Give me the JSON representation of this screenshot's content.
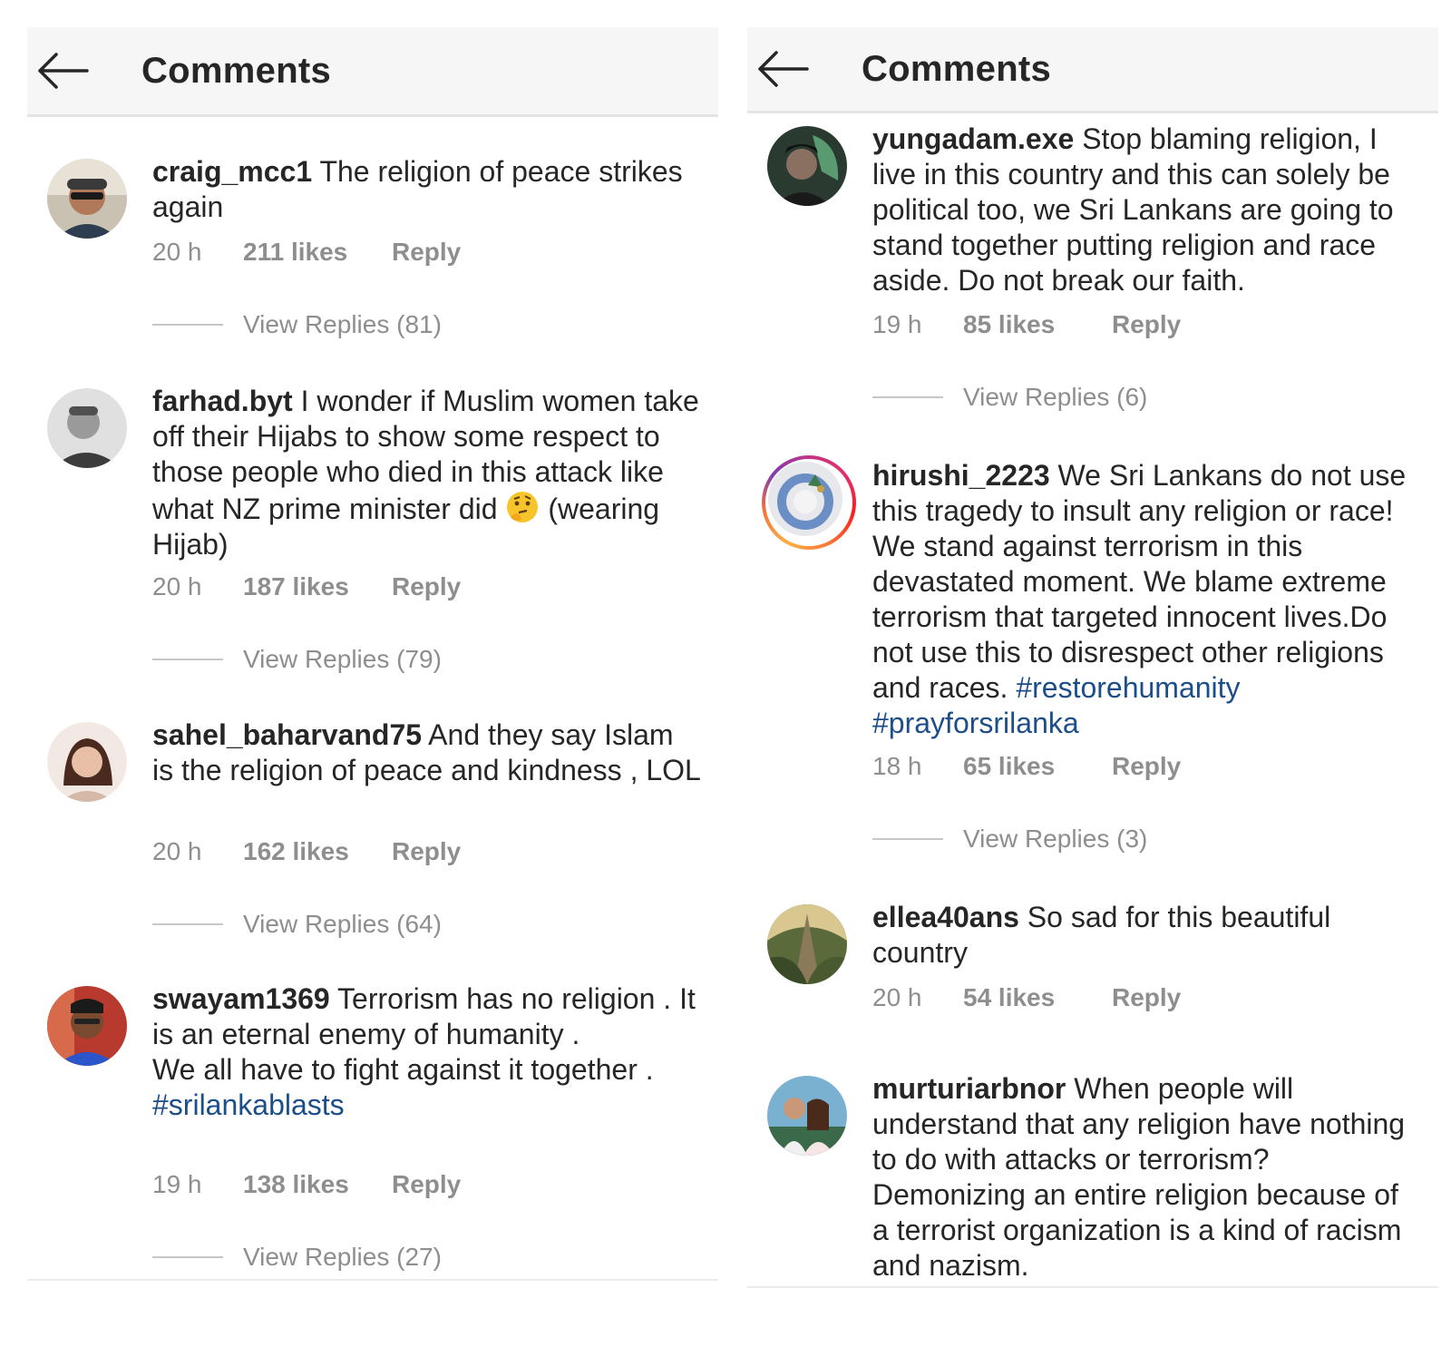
{
  "panels": [
    {
      "title": "Comments",
      "comments": [
        {
          "user": "craig_mcc1",
          "text": "The religion of peace strikes again",
          "time": "20 h",
          "likes": "211 likes",
          "reply": "Reply",
          "view_replies": "View Replies (81)"
        },
        {
          "user": "farhad.byt",
          "text": "I wonder if Muslim women take off their Hijabs to show some respect to those people who died in this attack like what NZ prime minister did",
          "emoji": "thinking-face",
          "text_after": "(wearing Hijab)",
          "time": "20 h",
          "likes": "187 likes",
          "reply": "Reply",
          "view_replies": "View Replies (79)"
        },
        {
          "user": "sahel_baharvand75",
          "text": "And they say Islam is the religion of peace and kindness , LOL",
          "time": "20 h",
          "likes": "162 likes",
          "reply": "Reply",
          "view_replies": "View Replies (64)"
        },
        {
          "user": "swayam1369",
          "text": "Terrorism has no religion . It is an eternal enemy of humanity .",
          "text2": "We all have to fight against it together .",
          "hashtag": "#srilankablasts",
          "time": "19 h",
          "likes": "138 likes",
          "reply": "Reply",
          "view_replies": "View Replies (27)"
        }
      ]
    },
    {
      "title": "Comments",
      "comments": [
        {
          "user": "yungadam.exe",
          "text": "Stop blaming religion, I live in this country and this can solely be political too, we Sri Lankans are going to stand together putting religion and race aside. Do not break our faith.",
          "time": "19 h",
          "likes": "85 likes",
          "reply": "Reply",
          "view_replies": "View Replies (6)"
        },
        {
          "user": "hirushi_2223",
          "text": "We Sri Lankans do not use this tragedy to insult any religion or race! We stand against terrorism in this devastated moment. We blame extreme terrorism that targeted innocent lives.Do not use this to disrespect other religions and races.",
          "hashtag1": "#restorehumanity",
          "hashtag2": "#prayforsrilanka",
          "time": "18 h",
          "likes": "65 likes",
          "reply": "Reply",
          "view_replies": "View Replies (3)"
        },
        {
          "user": "ellea40ans",
          "text": "So sad for this beautiful country",
          "time": "20 h",
          "likes": "54 likes",
          "reply": "Reply"
        },
        {
          "user": "murturiarbnor",
          "text": "When people will understand that any religion have nothing to do with attacks or terrorism? Demonizing an entire religion because of a terrorist organization is a kind of racism and nazism."
        }
      ]
    }
  ]
}
